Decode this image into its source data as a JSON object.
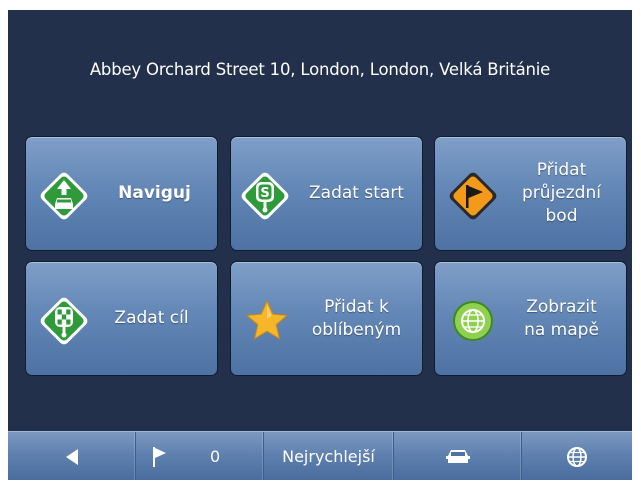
{
  "address": "Abbey Orchard Street 10, London, London, Velká Británie",
  "tiles": {
    "navigate": "Naviguj",
    "set_start": "Zadat start",
    "add_waypoint": [
      "Přidat",
      "průjezdní",
      "bod"
    ],
    "set_destination": "Zadat cíl",
    "add_favorite": [
      "Přidat k",
      "oblíbeným"
    ],
    "show_on_map": [
      "Zobrazit",
      "na mapě"
    ]
  },
  "bottom_bar": {
    "waypoint_count": "0",
    "route_mode": "Nejrychlejší"
  },
  "icons": {
    "navigate": "car-arrow-diamond-icon",
    "set_start": "start-flag-diamond-icon",
    "add_waypoint": "waypoint-flag-diamond-icon",
    "set_destination": "checkered-flag-diamond-icon",
    "add_favorite": "star-icon",
    "show_on_map": "globe-icon",
    "back": "back-arrow-icon",
    "waypoints": "flag-icon",
    "vehicle": "car-icon",
    "map": "globe-icon"
  },
  "colors": {
    "background": "#22304c",
    "tile": "#6387b6",
    "green_icon": "#2e9a3a",
    "orange_icon": "#f39a1b",
    "star": "#f7b52a"
  }
}
